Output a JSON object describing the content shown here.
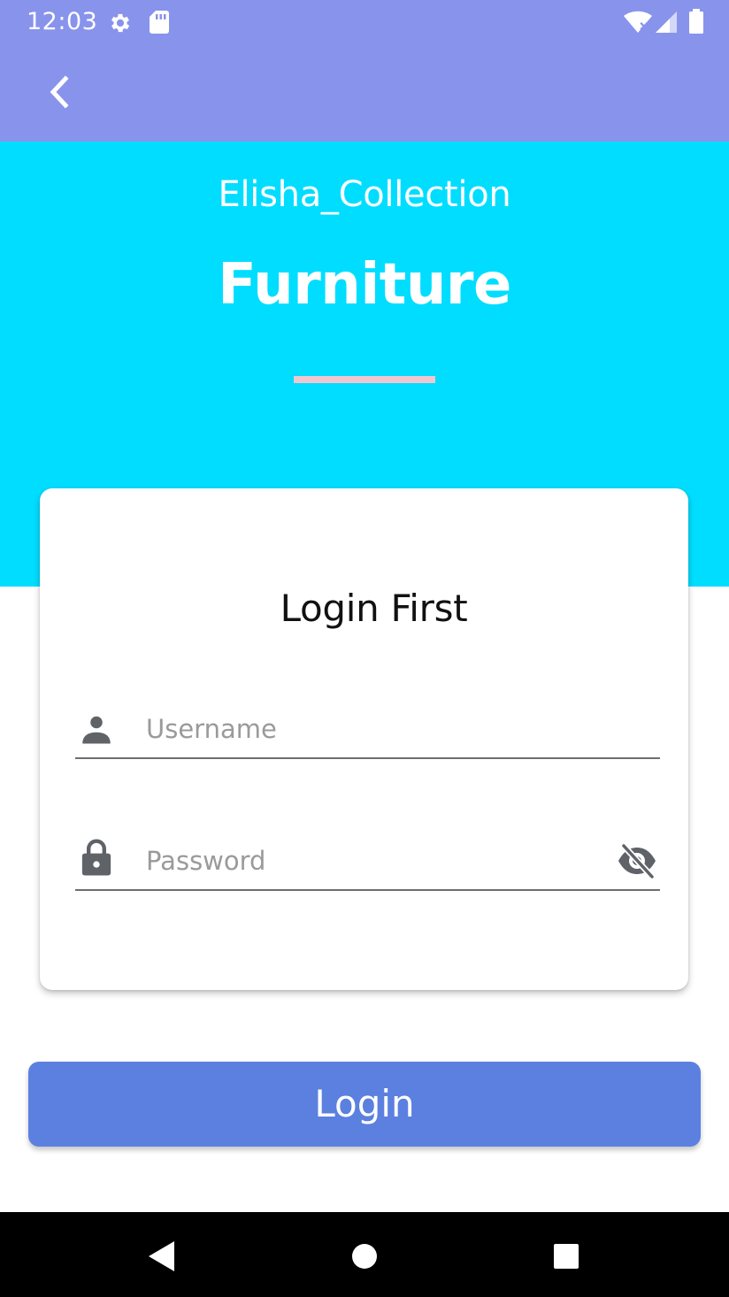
{
  "status_bar": {
    "time": "12:03",
    "icons": [
      "gear-icon",
      "sd-card-icon",
      "wifi-icon",
      "signal-icon",
      "battery-icon"
    ]
  },
  "toolbar": {
    "back_icon": "chevron-left-icon"
  },
  "header": {
    "brand_name": "Elisha_Collection",
    "title": "Furniture"
  },
  "login_card": {
    "title": "Login First",
    "username": {
      "placeholder": "Username",
      "value": "",
      "icon": "person-icon"
    },
    "password": {
      "placeholder": "Password",
      "value": "",
      "icon": "lock-icon",
      "toggle_icon": "visibility-off-icon"
    }
  },
  "login_button": {
    "label": "Login"
  },
  "nav_bar": {
    "icons": [
      "nav-back-icon",
      "nav-home-icon",
      "nav-recents-icon"
    ]
  },
  "colors": {
    "toolbar": "#8893EB",
    "header": "#00DDFF",
    "divider": "#F2C6CF",
    "button": "#5B80E0"
  }
}
